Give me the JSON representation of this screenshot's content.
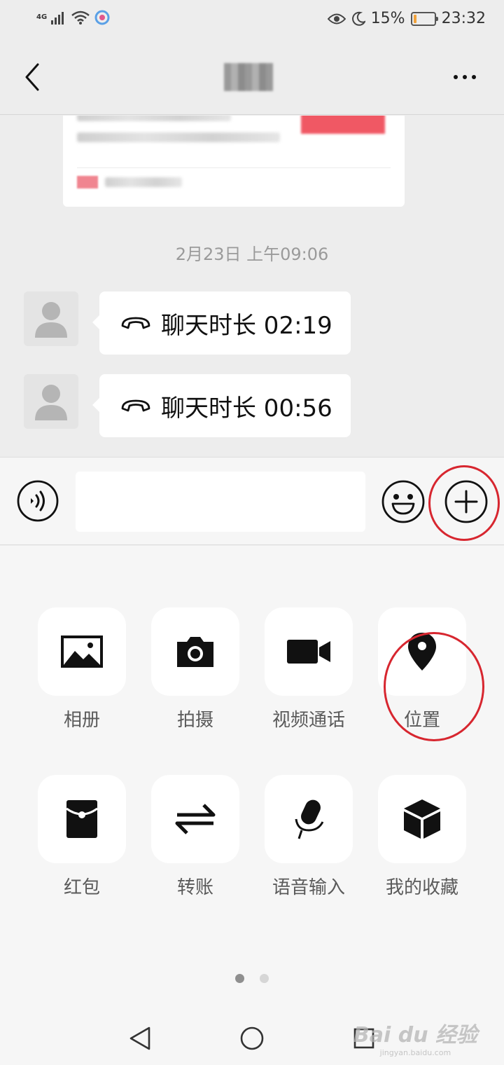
{
  "status_bar": {
    "network_type": "4G",
    "battery_percent": "15%",
    "battery_level": 0.15,
    "time": "23:32",
    "icons": [
      "signal-icon",
      "wifi-icon",
      "app-notification-icon",
      "eye-comfort-icon",
      "moon-icon",
      "battery-icon"
    ]
  },
  "nav": {
    "back_icon": "chevron-left-icon",
    "more_icon": "more-dots-icon"
  },
  "chat": {
    "timestamp": "2月23日 上午09:06",
    "messages": [
      {
        "icon": "phone-hangup-icon",
        "text": "聊天时长 02:19"
      },
      {
        "icon": "phone-hangup-icon",
        "text": "聊天时长 00:56"
      }
    ]
  },
  "input_bar": {
    "placeholder": "",
    "voice_icon": "voice-icon",
    "emoji_icon": "emoji-icon",
    "plus_icon": "plus-icon"
  },
  "panel": {
    "items": [
      {
        "icon": "photo-album-icon",
        "label": "相册"
      },
      {
        "icon": "camera-icon",
        "label": "拍摄"
      },
      {
        "icon": "video-call-icon",
        "label": "视频通话"
      },
      {
        "icon": "location-pin-icon",
        "label": "位置"
      },
      {
        "icon": "red-packet-icon",
        "label": "红包"
      },
      {
        "icon": "transfer-icon",
        "label": "转账"
      },
      {
        "icon": "microphone-icon",
        "label": "语音输入"
      },
      {
        "icon": "favorites-cube-icon",
        "label": "我的收藏"
      }
    ],
    "page_count": 2,
    "active_page": 1
  },
  "watermark": {
    "main": "Bai du 经验",
    "sub": "jingyan.baidu.com"
  },
  "colors": {
    "background": "#ededed",
    "annotation_red": "#d7262f",
    "battery_low": "#f1a23b"
  }
}
